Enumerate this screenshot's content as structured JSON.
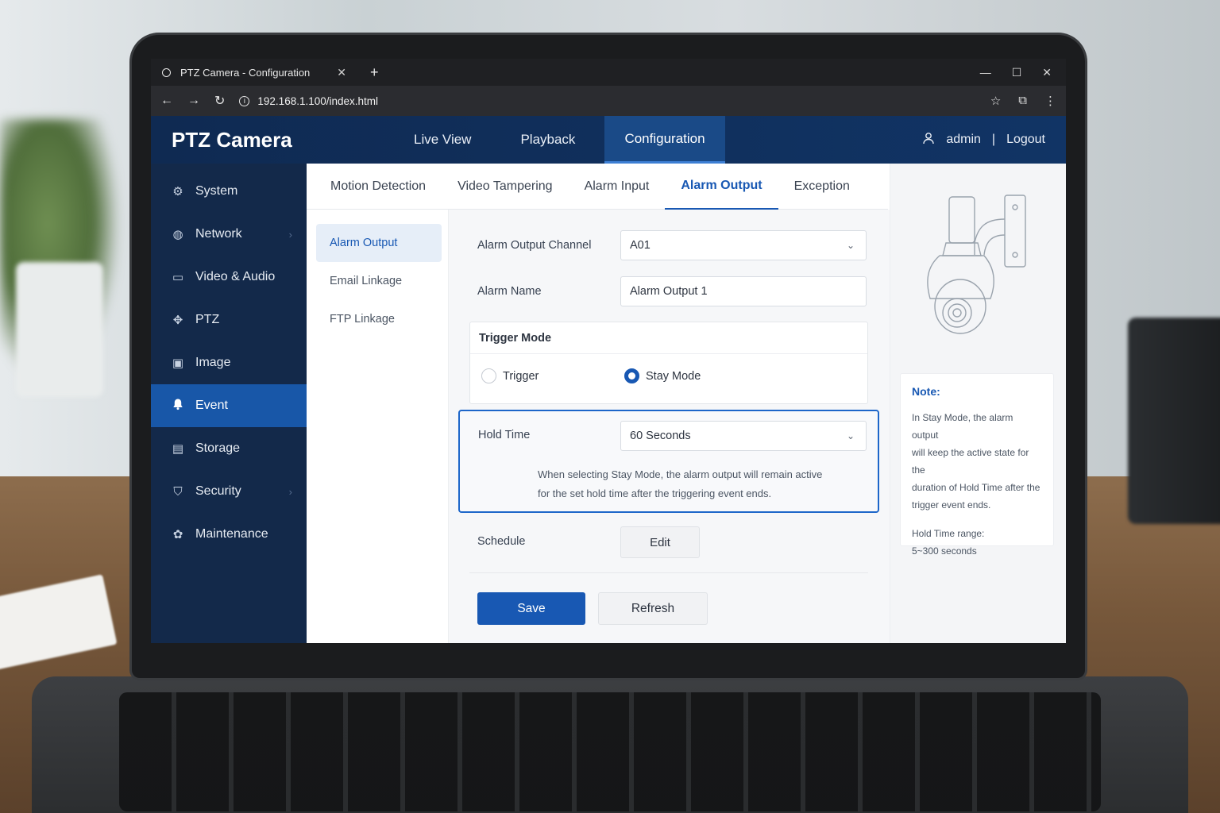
{
  "browser": {
    "tab_title": "PTZ Camera - Configuration",
    "url": "192.168.1.100/index.html"
  },
  "header": {
    "brand": "PTZ Camera",
    "nav": [
      "Live View",
      "Playback",
      "Configuration"
    ],
    "active_nav": "Configuration",
    "user": "admin",
    "separator": "|",
    "logout": "Logout"
  },
  "sidebar": {
    "items": [
      {
        "label": "System",
        "icon": "gear-icon"
      },
      {
        "label": "Network",
        "icon": "globe-icon"
      },
      {
        "label": "Video & Audio",
        "icon": "video-camera-icon"
      },
      {
        "label": "PTZ",
        "icon": "joystick-icon"
      },
      {
        "label": "Image",
        "icon": "image-icon"
      },
      {
        "label": "Event",
        "icon": "bell-icon"
      },
      {
        "label": "Storage",
        "icon": "storage-icon"
      },
      {
        "label": "Security",
        "icon": "shield-icon"
      },
      {
        "label": "Maintenance",
        "icon": "tools-icon"
      }
    ],
    "active": "Event"
  },
  "subtabs": {
    "items": [
      "Motion Detection",
      "Video Tampering",
      "Alarm Input",
      "Alarm Output",
      "Exception"
    ],
    "active": "Alarm Output"
  },
  "leftmenu": {
    "items": [
      "Alarm Output",
      "Email Linkage",
      "FTP Linkage"
    ],
    "active": "Alarm Output"
  },
  "form": {
    "channel_label": "Alarm Output Channel",
    "channel_value": "A01",
    "name_label": "Alarm Name",
    "name_value": "Alarm Output 1",
    "trigger_mode_title": "Trigger Mode",
    "trigger_option": "Trigger",
    "stay_option": "Stay Mode",
    "selected_mode": "Stay Mode",
    "hold_label": "Hold Time",
    "hold_value": "60 Seconds",
    "hold_help_1": "When selecting Stay Mode, the alarm output will remain active",
    "hold_help_2": "for the set hold time after the triggering event ends.",
    "schedule_label": "Schedule",
    "edit_button": "Edit",
    "save_button": "Save",
    "refresh_button": "Refresh"
  },
  "note": {
    "title": "Note:",
    "body_1": "In Stay Mode, the alarm output",
    "body_2": "will keep the active state for the",
    "body_3": "duration of Hold Time after the",
    "body_4": "trigger event ends.",
    "range_1": "Hold Time range:",
    "range_2": "5~300 seconds"
  },
  "colors": {
    "accent": "#1858b3",
    "header_bg": "#0f2a52",
    "sidebar_bg": "#13294a",
    "sidebar_active": "#1857a8"
  }
}
